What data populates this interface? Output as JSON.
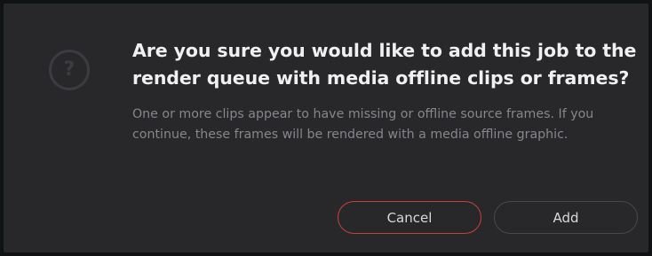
{
  "dialog": {
    "icon": "question-mark-circle-icon",
    "icon_glyph": "?",
    "title": "Are you sure you would like to add this job to the render queue with media offline clips or frames?",
    "message": "One or more clips appear to have missing or offline source frames. If you continue, these frames will be rendered with a media offline graphic.",
    "buttons": {
      "cancel_label": "Cancel",
      "add_label": "Add"
    },
    "colors": {
      "background": "#28282b",
      "title": "#f0f0f2",
      "message": "#86868b",
      "cancel_border": "#c6413a",
      "add_border": "#48484d"
    }
  }
}
